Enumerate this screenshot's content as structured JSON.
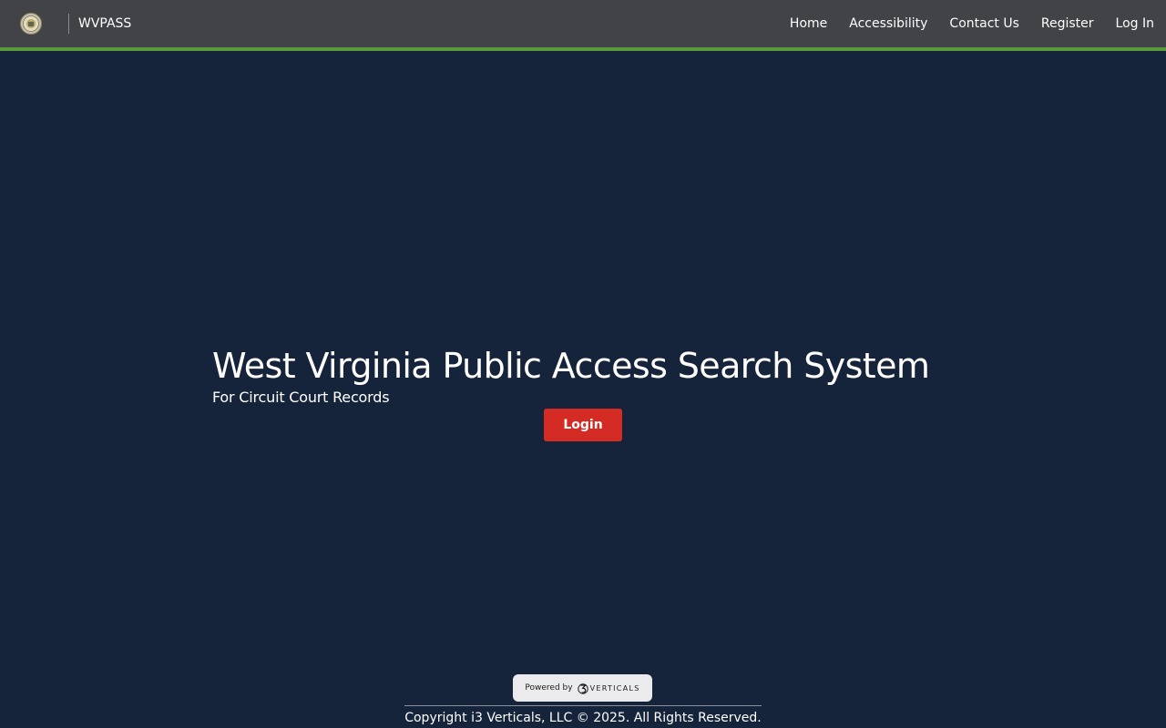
{
  "navbar": {
    "brand": "WVPASS",
    "links": [
      "Home",
      "Accessibility",
      "Contact Us",
      "Register",
      "Log In"
    ],
    "accent_color": "#5a9a3c"
  },
  "hero": {
    "title": "West Virginia Public Access Search System",
    "subtitle": "For Circuit Court Records",
    "login_label": "Login",
    "button_color": "#d42c24"
  },
  "footer": {
    "powered_by": "Powered by",
    "vendor": "VERTICALS",
    "copyright": "Copyright i3 Verticals, LLC © 2025. All Rights Reserved."
  },
  "icons": {
    "seal": "state-seal-icon",
    "vendor_mark": "i3-logo-icon"
  },
  "colors": {
    "background": "#15243a",
    "navbar": "#424347"
  }
}
